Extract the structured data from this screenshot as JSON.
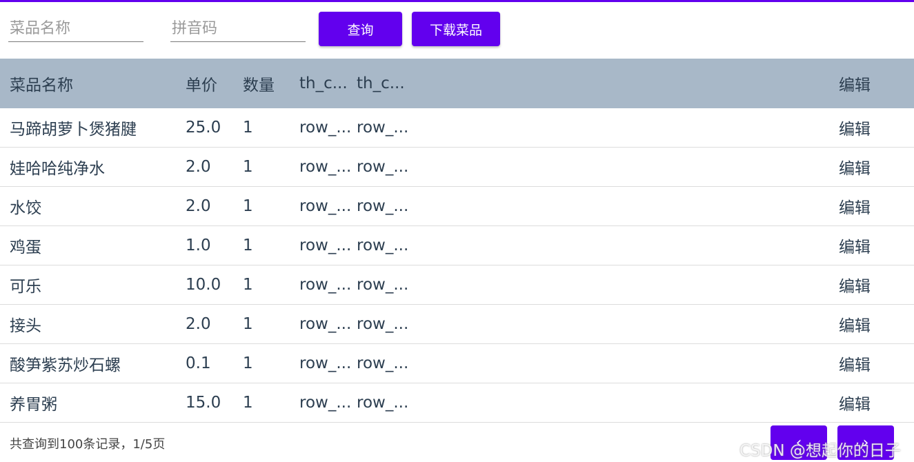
{
  "search": {
    "name_placeholder": "菜品名称",
    "pinyin_placeholder": "拼音码",
    "query_label": "查询",
    "download_label": "下载菜品"
  },
  "table": {
    "headers": {
      "name": "菜品名称",
      "price": "单价",
      "qty": "数量",
      "col3": "th_c...",
      "col4": "th_c...",
      "edit": "编辑"
    },
    "rows": [
      {
        "name": "马蹄胡萝卜煲猪腱",
        "price": "25.0",
        "qty": "1",
        "col3": "row_...",
        "col4": "row_...",
        "edit": "编辑"
      },
      {
        "name": "娃哈哈纯净水",
        "price": "2.0",
        "qty": "1",
        "col3": "row_...",
        "col4": "row_...",
        "edit": "编辑"
      },
      {
        "name": "水饺",
        "price": "2.0",
        "qty": "1",
        "col3": "row_...",
        "col4": "row_...",
        "edit": "编辑"
      },
      {
        "name": "鸡蛋",
        "price": "1.0",
        "qty": "1",
        "col3": "row_...",
        "col4": "row_...",
        "edit": "编辑"
      },
      {
        "name": "可乐",
        "price": "10.0",
        "qty": "1",
        "col3": "row_...",
        "col4": "row_...",
        "edit": "编辑"
      },
      {
        "name": "接头",
        "price": "2.0",
        "qty": "1",
        "col3": "row_...",
        "col4": "row_...",
        "edit": "编辑"
      },
      {
        "name": "酸笋紫苏炒石螺",
        "price": "0.1",
        "qty": "1",
        "col3": "row_...",
        "col4": "row_...",
        "edit": "编辑"
      },
      {
        "name": "养胃粥",
        "price": "15.0",
        "qty": "1",
        "col3": "row_...",
        "col4": "row_...",
        "edit": "编辑"
      }
    ]
  },
  "footer": {
    "record_info": "共查询到100条记录，1/5页",
    "prev_label": "‹",
    "next_label": "›",
    "watermark": "CSDN @想起你的日子"
  },
  "colors": {
    "accent": "#6200ee",
    "header_bg": "#a8b8c8",
    "text": "#2c3e50"
  }
}
